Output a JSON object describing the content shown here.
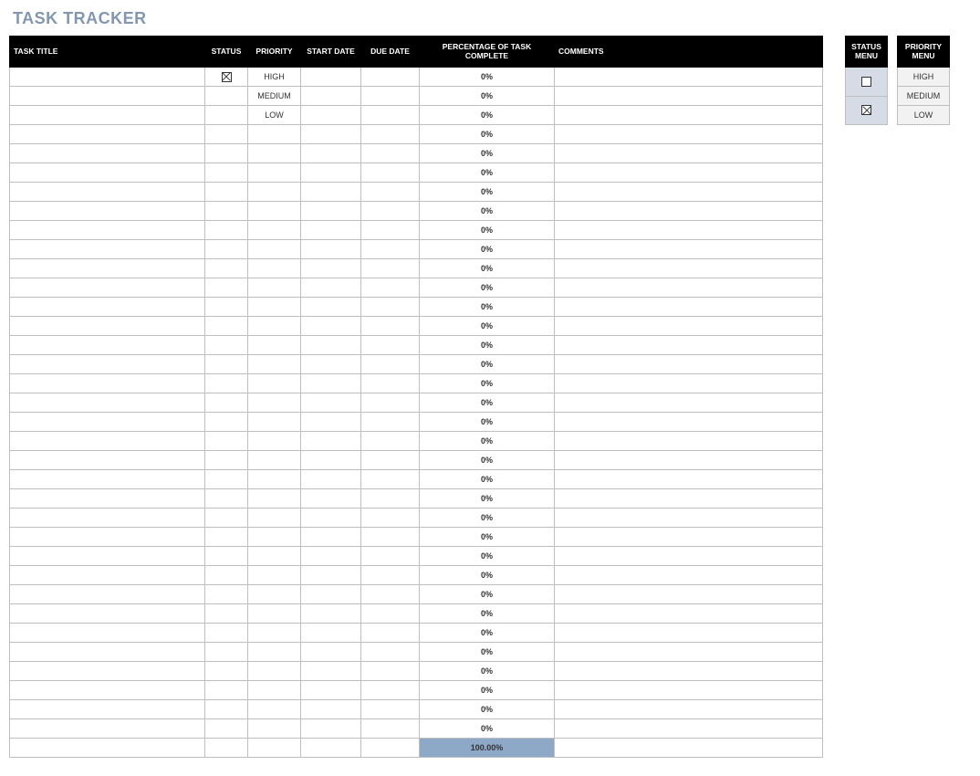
{
  "title": "TASK TRACKER",
  "columns": {
    "task_title": "TASK TITLE",
    "status": "STATUS",
    "priority": "PRIORITY",
    "start_date": "START DATE",
    "due_date": "DUE DATE",
    "pct": "PERCENTAGE OF TASK COMPLETE",
    "comments": "COMMENTS"
  },
  "rows": [
    {
      "task_title": "",
      "status_checked": true,
      "priority": "HIGH",
      "start_date": "",
      "due_date": "",
      "pct": "0%",
      "comments": ""
    },
    {
      "task_title": "",
      "status_checked": false,
      "priority": "MEDIUM",
      "start_date": "",
      "due_date": "",
      "pct": "0%",
      "comments": ""
    },
    {
      "task_title": "",
      "status_checked": false,
      "priority": "LOW",
      "start_date": "",
      "due_date": "",
      "pct": "0%",
      "comments": ""
    },
    {
      "task_title": "",
      "status_checked": false,
      "priority": "",
      "start_date": "",
      "due_date": "",
      "pct": "0%",
      "comments": ""
    },
    {
      "task_title": "",
      "status_checked": false,
      "priority": "",
      "start_date": "",
      "due_date": "",
      "pct": "0%",
      "comments": ""
    },
    {
      "task_title": "",
      "status_checked": false,
      "priority": "",
      "start_date": "",
      "due_date": "",
      "pct": "0%",
      "comments": ""
    },
    {
      "task_title": "",
      "status_checked": false,
      "priority": "",
      "start_date": "",
      "due_date": "",
      "pct": "0%",
      "comments": ""
    },
    {
      "task_title": "",
      "status_checked": false,
      "priority": "",
      "start_date": "",
      "due_date": "",
      "pct": "0%",
      "comments": ""
    },
    {
      "task_title": "",
      "status_checked": false,
      "priority": "",
      "start_date": "",
      "due_date": "",
      "pct": "0%",
      "comments": ""
    },
    {
      "task_title": "",
      "status_checked": false,
      "priority": "",
      "start_date": "",
      "due_date": "",
      "pct": "0%",
      "comments": ""
    },
    {
      "task_title": "",
      "status_checked": false,
      "priority": "",
      "start_date": "",
      "due_date": "",
      "pct": "0%",
      "comments": ""
    },
    {
      "task_title": "",
      "status_checked": false,
      "priority": "",
      "start_date": "",
      "due_date": "",
      "pct": "0%",
      "comments": ""
    },
    {
      "task_title": "",
      "status_checked": false,
      "priority": "",
      "start_date": "",
      "due_date": "",
      "pct": "0%",
      "comments": ""
    },
    {
      "task_title": "",
      "status_checked": false,
      "priority": "",
      "start_date": "",
      "due_date": "",
      "pct": "0%",
      "comments": ""
    },
    {
      "task_title": "",
      "status_checked": false,
      "priority": "",
      "start_date": "",
      "due_date": "",
      "pct": "0%",
      "comments": ""
    },
    {
      "task_title": "",
      "status_checked": false,
      "priority": "",
      "start_date": "",
      "due_date": "",
      "pct": "0%",
      "comments": ""
    },
    {
      "task_title": "",
      "status_checked": false,
      "priority": "",
      "start_date": "",
      "due_date": "",
      "pct": "0%",
      "comments": ""
    },
    {
      "task_title": "",
      "status_checked": false,
      "priority": "",
      "start_date": "",
      "due_date": "",
      "pct": "0%",
      "comments": ""
    },
    {
      "task_title": "",
      "status_checked": false,
      "priority": "",
      "start_date": "",
      "due_date": "",
      "pct": "0%",
      "comments": ""
    },
    {
      "task_title": "",
      "status_checked": false,
      "priority": "",
      "start_date": "",
      "due_date": "",
      "pct": "0%",
      "comments": ""
    },
    {
      "task_title": "",
      "status_checked": false,
      "priority": "",
      "start_date": "",
      "due_date": "",
      "pct": "0%",
      "comments": ""
    },
    {
      "task_title": "",
      "status_checked": false,
      "priority": "",
      "start_date": "",
      "due_date": "",
      "pct": "0%",
      "comments": ""
    },
    {
      "task_title": "",
      "status_checked": false,
      "priority": "",
      "start_date": "",
      "due_date": "",
      "pct": "0%",
      "comments": ""
    },
    {
      "task_title": "",
      "status_checked": false,
      "priority": "",
      "start_date": "",
      "due_date": "",
      "pct": "0%",
      "comments": ""
    },
    {
      "task_title": "",
      "status_checked": false,
      "priority": "",
      "start_date": "",
      "due_date": "",
      "pct": "0%",
      "comments": ""
    },
    {
      "task_title": "",
      "status_checked": false,
      "priority": "",
      "start_date": "",
      "due_date": "",
      "pct": "0%",
      "comments": ""
    },
    {
      "task_title": "",
      "status_checked": false,
      "priority": "",
      "start_date": "",
      "due_date": "",
      "pct": "0%",
      "comments": ""
    },
    {
      "task_title": "",
      "status_checked": false,
      "priority": "",
      "start_date": "",
      "due_date": "",
      "pct": "0%",
      "comments": ""
    },
    {
      "task_title": "",
      "status_checked": false,
      "priority": "",
      "start_date": "",
      "due_date": "",
      "pct": "0%",
      "comments": ""
    },
    {
      "task_title": "",
      "status_checked": false,
      "priority": "",
      "start_date": "",
      "due_date": "",
      "pct": "0%",
      "comments": ""
    },
    {
      "task_title": "",
      "status_checked": false,
      "priority": "",
      "start_date": "",
      "due_date": "",
      "pct": "0%",
      "comments": ""
    },
    {
      "task_title": "",
      "status_checked": false,
      "priority": "",
      "start_date": "",
      "due_date": "",
      "pct": "0%",
      "comments": ""
    },
    {
      "task_title": "",
      "status_checked": false,
      "priority": "",
      "start_date": "",
      "due_date": "",
      "pct": "0%",
      "comments": ""
    },
    {
      "task_title": "",
      "status_checked": false,
      "priority": "",
      "start_date": "",
      "due_date": "",
      "pct": "0%",
      "comments": ""
    },
    {
      "task_title": "",
      "status_checked": false,
      "priority": "",
      "start_date": "",
      "due_date": "",
      "pct": "0%",
      "comments": ""
    }
  ],
  "total_pct": "100.00%",
  "status_menu": {
    "header": "STATUS MENU",
    "items": [
      {
        "checked": false
      },
      {
        "checked": true
      }
    ]
  },
  "priority_menu": {
    "header": "PRIORITY MENU",
    "items": [
      "HIGH",
      "MEDIUM",
      "LOW"
    ]
  }
}
